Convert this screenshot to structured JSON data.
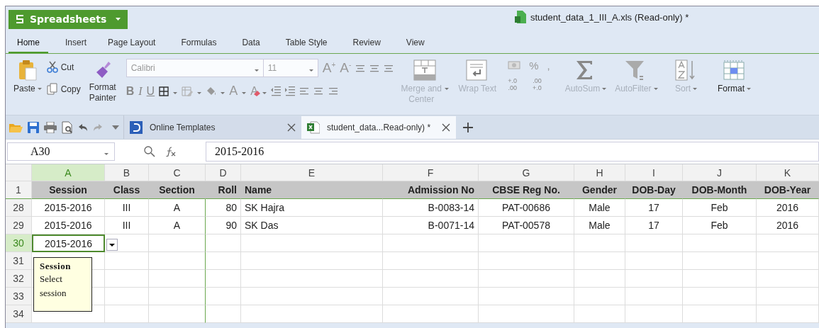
{
  "app_button": {
    "label": "Spreadsheets"
  },
  "window": {
    "title": "student_data_1_III_A.xls (Read-only) *"
  },
  "menu_tabs": [
    {
      "label": "Home",
      "selected": true
    },
    {
      "label": "Insert",
      "selected": false
    },
    {
      "label": "Page Layout",
      "selected": false
    },
    {
      "label": "Formulas",
      "selected": false
    },
    {
      "label": "Data",
      "selected": false
    },
    {
      "label": "Table Style",
      "selected": false
    },
    {
      "label": "Review",
      "selected": false
    },
    {
      "label": "View",
      "selected": false
    }
  ],
  "ribbon": {
    "paste": {
      "label": "Paste"
    },
    "clipboard": [
      {
        "kind": "cut",
        "label": "Cut"
      },
      {
        "kind": "copy",
        "label": "Copy"
      }
    ],
    "format_painter": {
      "label": "Format Painter"
    },
    "font_name": "Calibri",
    "font_size": "11",
    "size_buttons": [
      "A$^{+}$",
      "A$^{-}$"
    ],
    "style_buttons": [
      {
        "kind": "bold",
        "text": "B"
      },
      {
        "kind": "italic",
        "text": "I"
      },
      {
        "kind": "underline",
        "text": "U"
      }
    ],
    "font_color": "A",
    "clear_format": "A",
    "commands": [
      {
        "kind": "merge",
        "label": "Merge and Center",
        "disabled": true,
        "dropdown": true
      },
      {
        "kind": "wrap",
        "label": "Wrap Text",
        "disabled": true,
        "dropdown": false
      }
    ],
    "number_glyphs": [
      "%",
      ","
    ],
    "decimal_buttons": [
      [
        "+.0",
        ".00"
      ],
      [
        ".00",
        "+.0"
      ]
    ],
    "tools": [
      {
        "kind": "autosum",
        "label": "AutoSum",
        "disabled": true,
        "dropdown": true
      },
      {
        "kind": "autofilter",
        "label": "AutoFilter",
        "disabled": true,
        "dropdown": true
      },
      {
        "kind": "sort",
        "label": "Sort",
        "disabled": true,
        "dropdown": true
      },
      {
        "kind": "format",
        "label": "Format",
        "disabled": false,
        "dropdown": true
      }
    ]
  },
  "doc_tabs": [
    {
      "kind": "templates",
      "label": "Online Templates",
      "selected": false
    },
    {
      "kind": "sheet",
      "label": "student_data...Read-only) *",
      "selected": true
    }
  ],
  "formula_bar": {
    "name_box": "A30",
    "formula": "2015-2016"
  },
  "columns": [
    {
      "letter": "A",
      "selected": true
    },
    {
      "letter": "B",
      "selected": false
    },
    {
      "letter": "C",
      "selected": false
    },
    {
      "letter": "D",
      "selected": false
    },
    {
      "letter": "E",
      "selected": false
    },
    {
      "letter": "F",
      "selected": false
    },
    {
      "letter": "G",
      "selected": false
    },
    {
      "letter": "H",
      "selected": false
    },
    {
      "letter": "I",
      "selected": false
    },
    {
      "letter": "J",
      "selected": false
    },
    {
      "letter": "K",
      "selected": false
    }
  ],
  "rows": [
    {
      "number": "1",
      "kind": "heading",
      "selected": false,
      "frozen": true,
      "cells": [
        "Session",
        "Class",
        "Section",
        "Roll",
        "Name",
        "Admission No",
        "CBSE Reg No.",
        "Gender",
        "DOB-Day",
        "DOB-Month",
        "DOB-Year"
      ]
    },
    {
      "number": "28",
      "kind": "data",
      "selected": false,
      "frozen": false,
      "cells": [
        "2015-2016",
        "III",
        "A",
        "80",
        "SK Hajra",
        "B-0083-14",
        "PAT-00686",
        "Male",
        "17",
        "Feb",
        "2016"
      ]
    },
    {
      "number": "29",
      "kind": "data",
      "selected": false,
      "frozen": false,
      "cells": [
        "2015-2016",
        "III",
        "A",
        "90",
        "SK Das",
        "B-0071-14",
        "PAT-00578",
        "Male",
        "17",
        "Feb",
        "2016"
      ]
    },
    {
      "number": "30",
      "kind": "data",
      "selected": true,
      "frozen": false,
      "cells": [
        "2015-2016"
      ]
    },
    {
      "number": "31",
      "kind": "data",
      "selected": false,
      "frozen": false,
      "cells": []
    },
    {
      "number": "32",
      "kind": "data",
      "selected": false,
      "frozen": false,
      "cells": []
    },
    {
      "number": "33",
      "kind": "data",
      "selected": false,
      "frozen": false,
      "cells": []
    },
    {
      "number": "34",
      "kind": "data",
      "selected": false,
      "frozen": false,
      "cells": []
    }
  ],
  "input_message": {
    "title": "Session",
    "text": "Select session"
  }
}
